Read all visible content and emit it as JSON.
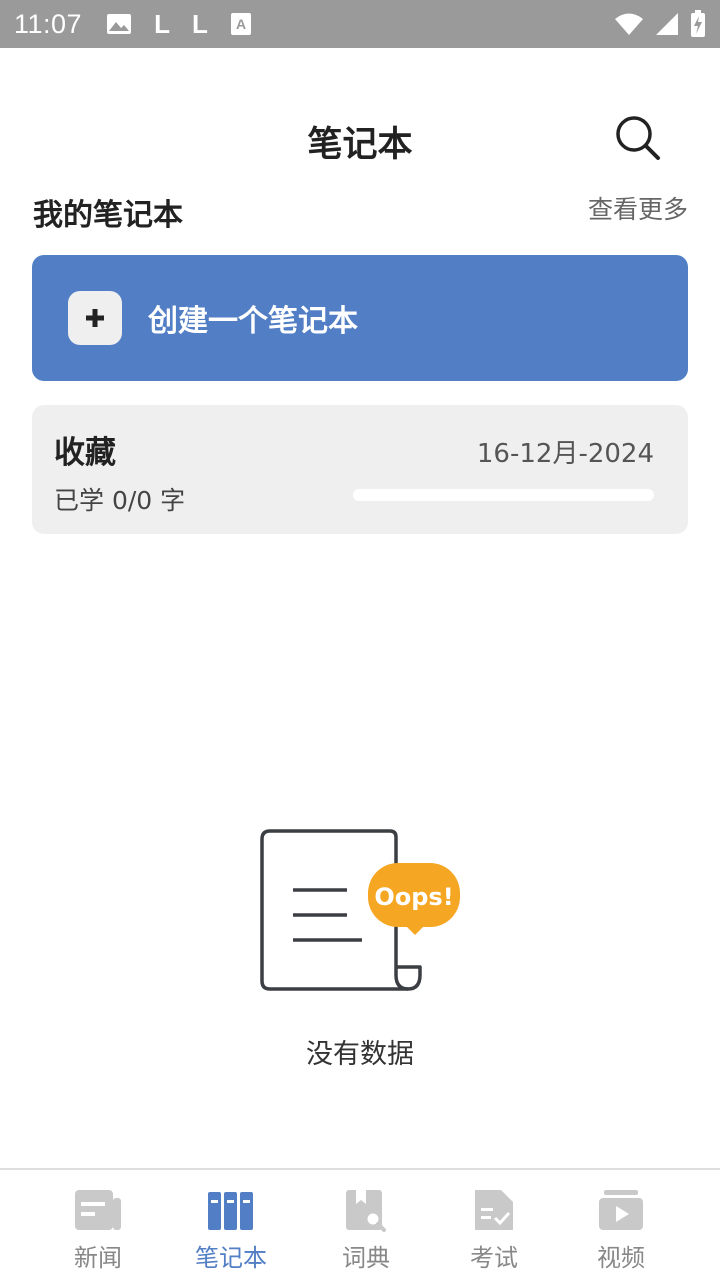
{
  "status_bar": {
    "time": "11:07",
    "left_icons": [
      "image-icon",
      "l-icon",
      "l-icon",
      "a-icon"
    ],
    "right_icons": [
      "wifi-icon",
      "signal-icon",
      "battery-icon"
    ]
  },
  "header": {
    "title": "笔记本",
    "search_icon": "search-icon"
  },
  "my_notebooks": {
    "title": "我的笔记本",
    "see_more": "查看更多"
  },
  "create_button": {
    "icon": "plus-icon",
    "label": "创建一个笔记本"
  },
  "notebooks": [
    {
      "name": "收藏",
      "date": "16-12月-2024",
      "progress_text": "已学 0/0 字",
      "progress": 0
    }
  ],
  "empty_state": {
    "badge": "Oops!",
    "text": "没有数据"
  },
  "bottom_nav": [
    {
      "label": "新闻",
      "icon": "news-icon",
      "active": false
    },
    {
      "label": "笔记本",
      "icon": "notebook-icon",
      "active": true
    },
    {
      "label": "词典",
      "icon": "dictionary-icon",
      "active": false
    },
    {
      "label": "考试",
      "icon": "exam-icon",
      "active": false
    },
    {
      "label": "视频",
      "icon": "video-icon",
      "active": false
    }
  ],
  "colors": {
    "accent": "#517ec4",
    "status_bar": "#9a9a9a",
    "oops_badge": "#f5a623",
    "card_bg": "#efefef",
    "nav_inactive": "#888888"
  }
}
